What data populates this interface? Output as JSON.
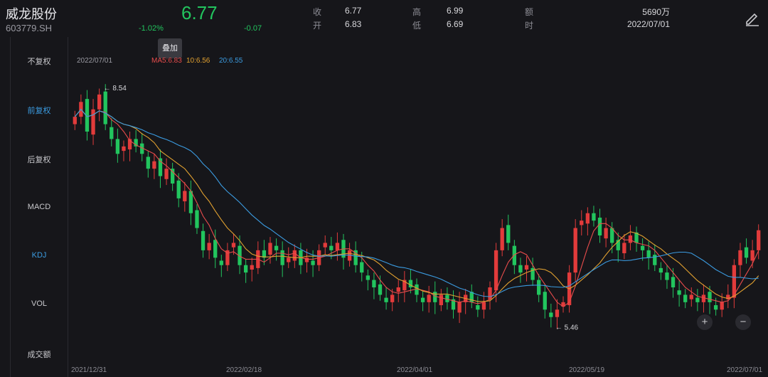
{
  "stock": {
    "name": "威龙股份",
    "code": "603779.SH",
    "price": "6.77",
    "change_pct": "-1.02%",
    "change": "-0.07"
  },
  "quote": {
    "close_label": "收",
    "close": "6.77",
    "open_label": "开",
    "open": "6.83",
    "high_label": "高",
    "high": "6.99",
    "low_label": "低",
    "low": "6.69",
    "amount_label": "额",
    "amount": "5690万",
    "time_label": "时",
    "time": "2022/07/01"
  },
  "side_menu": {
    "items": [
      {
        "label": "不复权"
      },
      {
        "label": "前复权"
      },
      {
        "label": "后复权"
      },
      {
        "label": "MACD"
      },
      {
        "label": "KDJ"
      },
      {
        "label": "VOL"
      },
      {
        "label": "成交额"
      }
    ],
    "active_indices": [
      1,
      4
    ]
  },
  "tooltip": "叠加",
  "ma_legend": {
    "date": "2022/07/01",
    "ma5": "MA5:6.83",
    "ma10": "10:6.56",
    "ma20": "20:6.55",
    "colors": {
      "ma5": "#e84c4c",
      "ma10": "#e0a030",
      "ma20": "#3b9be0"
    }
  },
  "chart_data": {
    "type": "candlestick",
    "high_marker": "8.54",
    "low_marker": "5.46",
    "x_ticks": [
      "2021/12/31",
      "2022/02/18",
      "2022/04/01",
      "2022/05/19",
      "2022/07/01"
    ],
    "colors": {
      "up": "#e23b3b",
      "down": "#22c55e"
    },
    "closes": [
      8.3,
      8.5,
      8.1,
      8.4,
      8.6,
      8.2,
      8.0,
      7.8,
      7.9,
      8.0,
      7.9,
      7.8,
      7.6,
      7.7,
      7.5,
      7.6,
      7.4,
      7.2,
      7.3,
      7.0,
      6.8,
      6.5,
      6.6,
      6.4,
      6.3,
      6.5,
      6.6,
      6.3,
      6.2,
      6.3,
      6.5,
      6.4,
      6.6,
      6.5,
      6.3,
      6.4,
      6.5,
      6.3,
      6.4,
      6.3,
      6.5,
      6.6,
      6.5,
      6.6,
      6.4,
      6.5,
      6.3,
      6.2,
      6.1,
      6.0,
      5.9,
      5.8,
      5.9,
      6.0,
      6.1,
      6.0,
      5.9,
      5.8,
      5.9,
      5.8,
      5.9,
      5.8,
      5.7,
      5.8,
      5.9,
      5.8,
      5.7,
      5.8,
      6.0,
      6.5,
      6.8,
      6.6,
      6.3,
      6.2,
      6.3,
      6.1,
      5.9,
      5.7,
      5.6,
      5.7,
      5.8,
      6.2,
      6.8,
      6.9,
      7.0,
      6.9,
      6.7,
      6.8,
      6.6,
      6.5,
      6.6,
      6.7,
      6.6,
      6.5,
      6.4,
      6.3,
      6.2,
      6.1,
      6.0,
      5.9,
      5.8,
      5.9,
      5.8,
      5.9,
      5.8,
      5.7,
      5.8,
      5.9,
      6.3,
      6.5,
      6.4,
      6.5,
      6.77
    ]
  }
}
